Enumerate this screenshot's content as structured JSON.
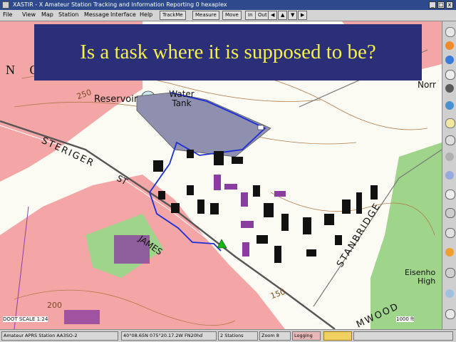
{
  "window": {
    "title": "XASTIR - X Amateur Station Tracking and Information Reporting 0 hexaplex",
    "controls": [
      "_",
      "□",
      "x"
    ]
  },
  "menus": [
    "File",
    "View",
    "Map",
    "Station",
    "Message",
    "Interface",
    "Help"
  ],
  "toolbar": {
    "trackme": "TrackMe",
    "measure": "Measure",
    "move": "Move",
    "zoom_in": "In",
    "zoom_out": "Out",
    "nav": [
      "◀",
      "▲",
      "▼",
      "▶"
    ]
  },
  "overlay": {
    "slide_title": "Is a task where it is supposed to be?"
  },
  "map": {
    "labels": {
      "north_fragment": "N O",
      "reservoir": "Reservoir",
      "water_tank": "Water Tank",
      "steriger": "STERIGER",
      "st": "ST",
      "james": "JAMES",
      "stanbridge": "STANBRIDGE",
      "eisenhower": "Eisenho",
      "high": "High",
      "mwood": "MWOOD",
      "elev_250": "250",
      "elev_200": "200",
      "elev_150": "150",
      "norr": "Norr",
      "scale_left": "DOOT SCALE 1:24",
      "scale_right": "1000 ft"
    },
    "colors": {
      "urban": "#f4a6a6",
      "paper": "#fbfbf3",
      "task_area": "#8f8fb0",
      "track": "#1b2fd6",
      "building": "#111111",
      "building_purple": "#8a3fa0",
      "woods": "#9fd58b"
    }
  },
  "status": {
    "station": "Amateur APRS Station AA3SO-2",
    "coords": "40°08.65N  075°20.17.2W  FN20hd",
    "stations": "2 Stations",
    "zoom": "Zoom 8",
    "logging": "Logging"
  }
}
